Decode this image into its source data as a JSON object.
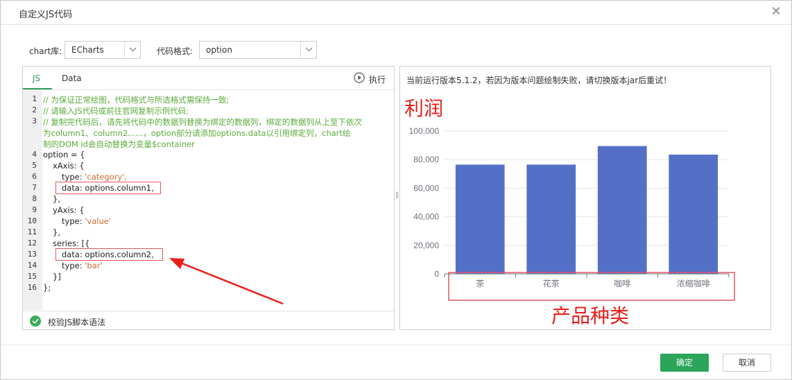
{
  "dialog": {
    "title": "自定义JS代码"
  },
  "toolbar": {
    "chart_lib_label": "chart库:",
    "chart_lib_value": "ECharts",
    "code_format_label": "代码格式:",
    "code_format_value": "option"
  },
  "editor": {
    "tabs": [
      {
        "label": "JS"
      },
      {
        "label": "Data"
      }
    ],
    "run_label": "执行",
    "line_numbers": [
      "1",
      "2",
      "3",
      "4",
      "5",
      "6",
      "7",
      "8",
      "9",
      "10",
      "11",
      "12",
      "13",
      "14",
      "15",
      "16"
    ],
    "lines": {
      "l1": "// 为保证正常绘图，代码格式与所选格式需保持一致;",
      "l2": "// 请输入JS代码或前往官网复制示例代码;",
      "l3a": "// 复制完代码后，请先将代码中的数据列替换为绑定的数据列，绑定的数据列从上至下依次",
      "l3b": "为column1、column2......，option部分请添加options.data以引用绑定列，chart绘",
      "l3c": "制的DOM id会自动替换为变量$container",
      "l4": "option = {",
      "l5": "xAxis: {",
      "l6_key": "type: ",
      "l6_val": "'category',",
      "l7": "data: options.column1,",
      "l8": "},",
      "l9": "yAxis: {",
      "l10_key": "type: ",
      "l10_val": "'value'",
      "l11": "},",
      "l12": "series: [{",
      "l13": "data: options.column2,",
      "l14_key": "type: ",
      "l14_val": "'bar'",
      "l15": "}]",
      "l16": "};"
    },
    "validate_label": "校验JS脚本语法"
  },
  "preview": {
    "notice": "当前运行版本5.1.2，若因为版本问题绘制失败，请切换版本jar后重试！"
  },
  "footer": {
    "confirm_label": "确定",
    "cancel_label": "取消"
  },
  "colors": {
    "accent": "#2aa55a",
    "bar": "#5470c6",
    "annotation": "#e8201a"
  },
  "chart_data": {
    "type": "bar",
    "categories": [
      "茶",
      "花茶",
      "咖啡",
      "浓缩咖啡"
    ],
    "values": [
      76500,
      76500,
      89500,
      83500
    ],
    "ylim": [
      0,
      100000
    ],
    "yticks": [
      "0",
      "20,000",
      "40,000",
      "60,000",
      "80,000",
      "100,000"
    ],
    "yaxis_annotation": "利润",
    "xaxis_annotation": "产品种类",
    "grid": true
  }
}
